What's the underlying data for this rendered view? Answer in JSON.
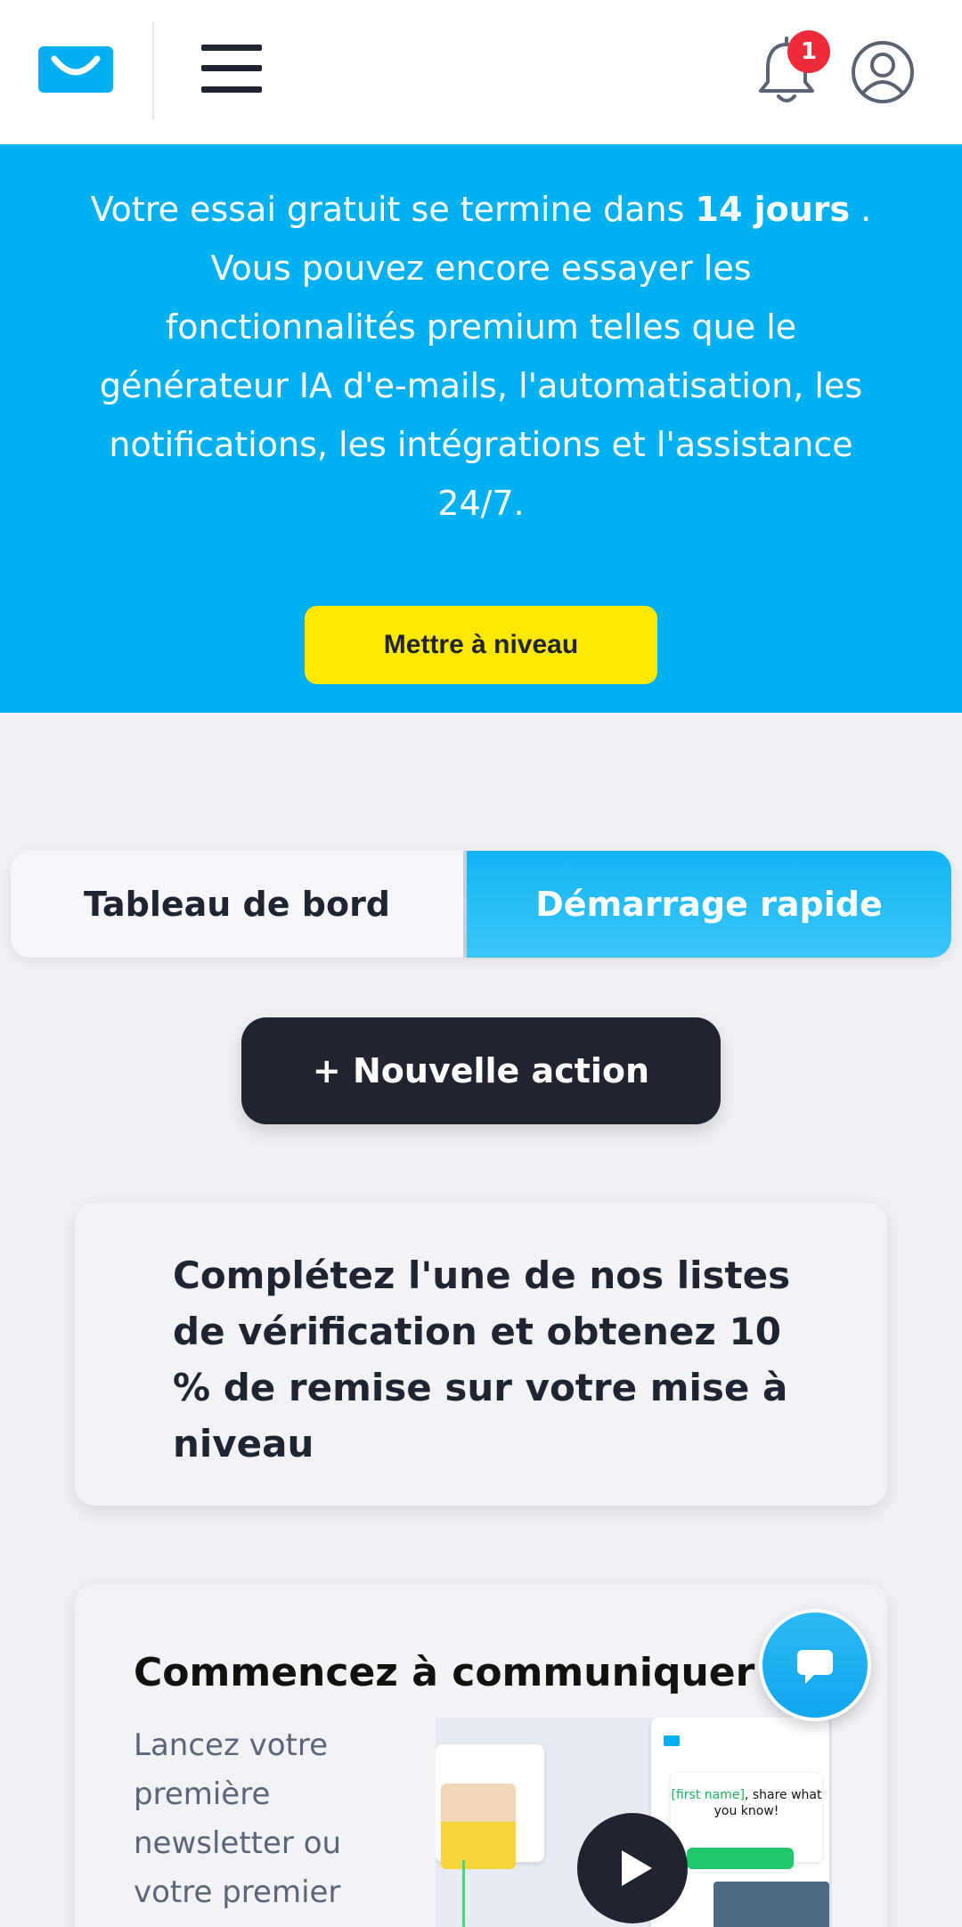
{
  "header": {
    "notification_count": "1"
  },
  "banner": {
    "line1_prefix": "Votre essai gratuit se termine dans ",
    "line1_days": "14 jours",
    "line1_suffix": " .",
    "line2": "Vous pouvez encore essayer les fonctionnalités premium telles que le générateur IA d'e-mails, l'automatisation, les notifications, les intégrations et l'assistance 24/7.",
    "upgrade_label": "Mettre à niveau"
  },
  "tabs": [
    {
      "label": "Tableau de bord",
      "active": false
    },
    {
      "label": "Démarrage rapide",
      "active": true
    }
  ],
  "new_action_label": "+ Nouvelle action",
  "checklist_card": {
    "title": "Complétez l'une de nos listes de vérification et obtenez 10 % de remise sur votre mise à niveau"
  },
  "communicate_card": {
    "title": "Commencez à communiquer",
    "description": "Lancez votre première newsletter ou votre premier",
    "preview_text_highlight": "[first name]",
    "preview_text_rest": ", share what you know!"
  },
  "colors": {
    "brand": "#00b1f2",
    "upgrade": "#ffe800",
    "dark": "#20242e",
    "badge": "#ee2b3b"
  },
  "icons": [
    "logo-icon",
    "hamburger-menu-icon",
    "bell-icon",
    "user-avatar-icon",
    "play-icon",
    "chat-icon"
  ]
}
